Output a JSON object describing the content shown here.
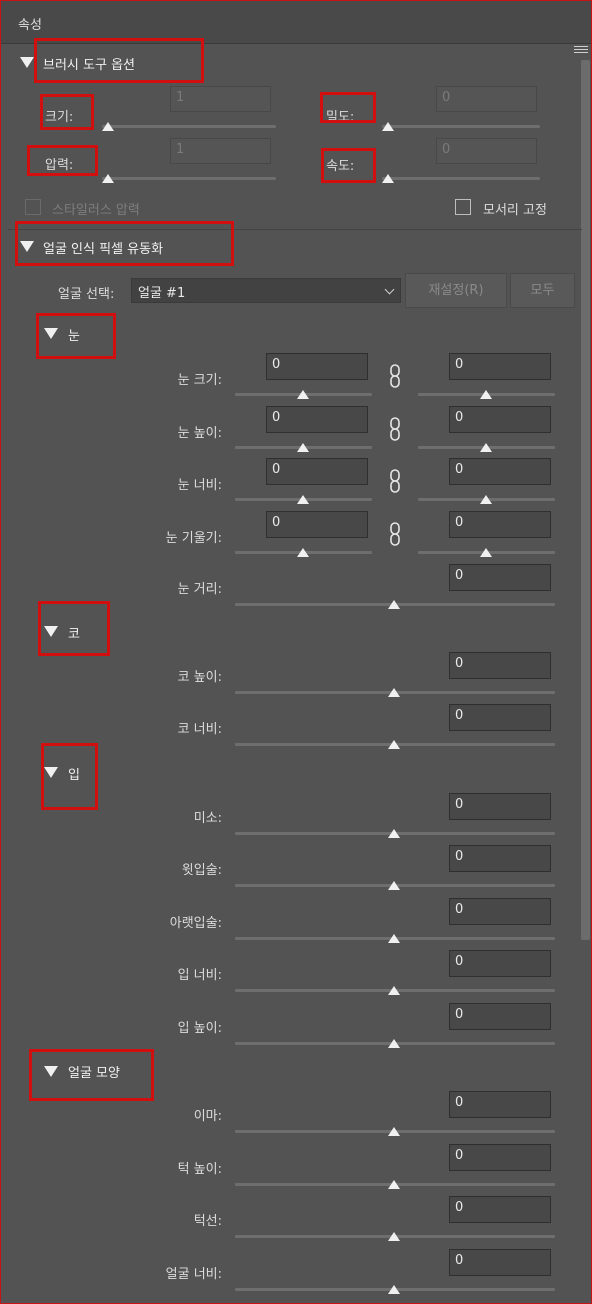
{
  "panel": {
    "title": "속성"
  },
  "brush": {
    "section_label": "브러시 도구 옵션",
    "size_label": "크기:",
    "size_value": "1",
    "size_level": 0,
    "density_label": "밀도:",
    "density_value": "0",
    "density_level": 0,
    "pressure_label": "압력:",
    "pressure_value": "1",
    "pressure_level": 0,
    "rate_label": "속도:",
    "rate_value": "0",
    "rate_level": 0,
    "stylus_label": "스타일러스 압력",
    "pin_edges_label": "모서리 고정"
  },
  "face": {
    "section_label": "얼굴 인식 픽셀 유동화",
    "select_label": "얼굴 선택:",
    "select_value": "얼굴 #1",
    "reset_label": "재설정(R)",
    "all_label": "모두"
  },
  "eyes": {
    "section_label": "눈",
    "rows": [
      {
        "label": "눈 크기:",
        "left": "0",
        "right": "0"
      },
      {
        "label": "눈 높이:",
        "left": "0",
        "right": "0"
      },
      {
        "label": "눈 너비:",
        "left": "0",
        "right": "0"
      },
      {
        "label": "눈 기울기:",
        "left": "0",
        "right": "0"
      }
    ],
    "distance_label": "눈 거리:",
    "distance_value": "0"
  },
  "nose": {
    "section_label": "코",
    "rows": [
      {
        "label": "코 높이:",
        "value": "0"
      },
      {
        "label": "코 너비:",
        "value": "0"
      }
    ]
  },
  "mouth": {
    "section_label": "입",
    "rows": [
      {
        "label": "미소:",
        "value": "0"
      },
      {
        "label": "윗입술:",
        "value": "0"
      },
      {
        "label": "아랫입술:",
        "value": "0"
      },
      {
        "label": "입 너비:",
        "value": "0"
      },
      {
        "label": "입 높이:",
        "value": "0"
      }
    ]
  },
  "face_shape": {
    "section_label": "얼굴 모양",
    "rows": [
      {
        "label": "이마:",
        "value": "0"
      },
      {
        "label": "턱 높이:",
        "value": "0"
      },
      {
        "label": "턱선:",
        "value": "0"
      },
      {
        "label": "얼굴 너비:",
        "value": "0"
      }
    ]
  },
  "colors": {
    "highlight": "#d10f0f",
    "panel_bg": "#535353"
  }
}
